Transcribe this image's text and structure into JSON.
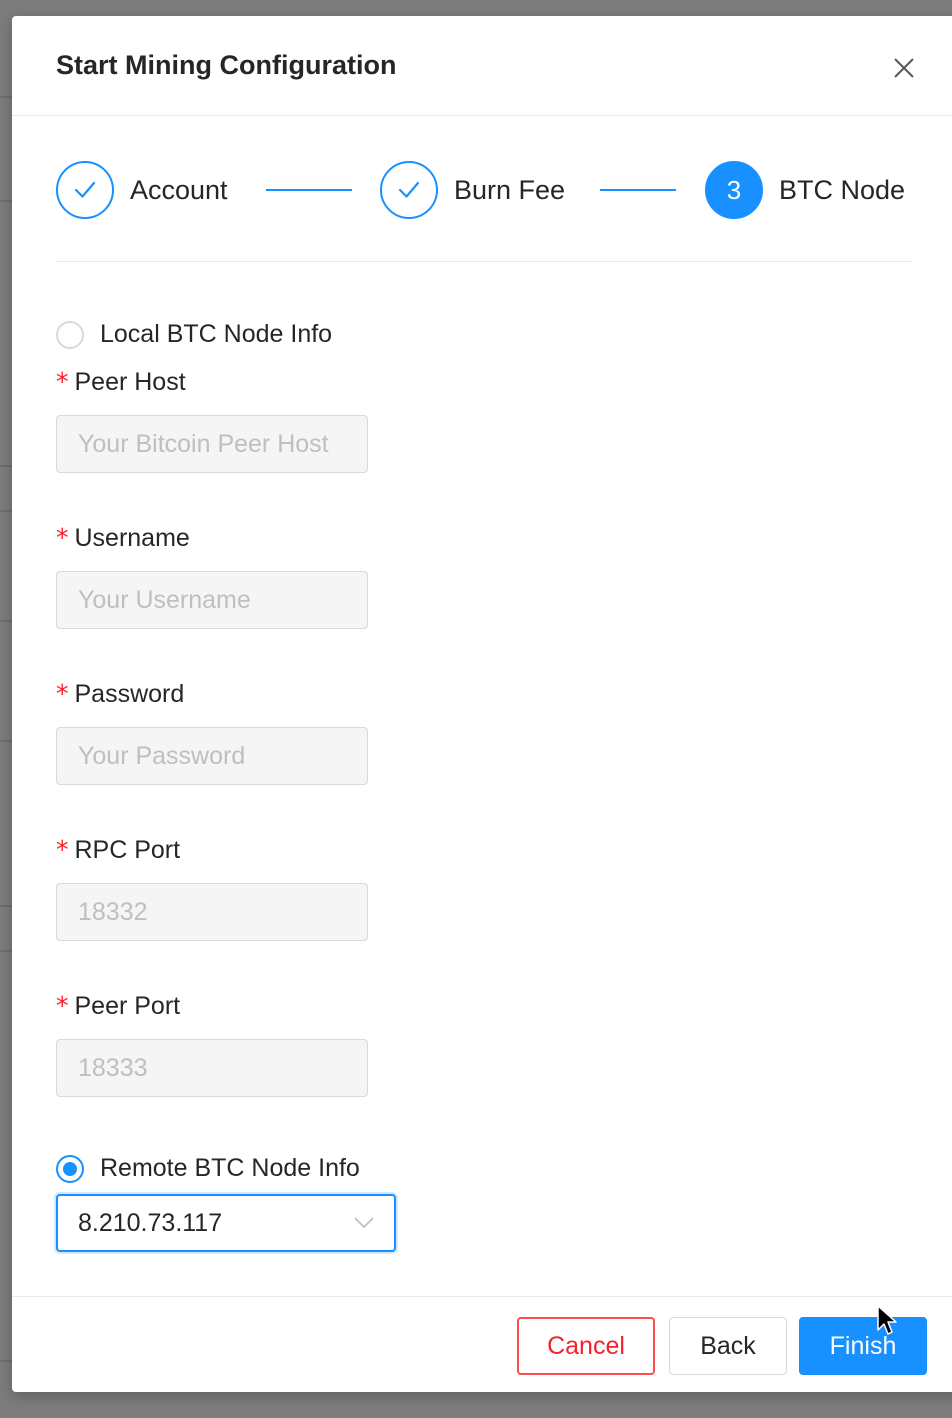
{
  "modal": {
    "title": "Start Mining Configuration"
  },
  "steps": [
    {
      "label": "Account",
      "status": "finished"
    },
    {
      "label": "Burn Fee",
      "status": "finished"
    },
    {
      "label": "BTC Node",
      "status": "active",
      "number": "3"
    }
  ],
  "local_node": {
    "radio_label": "Local BTC Node Info",
    "checked": false,
    "fields": [
      {
        "label": "Peer Host",
        "placeholder": "Your Bitcoin Peer Host",
        "required": true
      },
      {
        "label": "Username",
        "placeholder": "Your Username",
        "required": true
      },
      {
        "label": "Password",
        "placeholder": "Your Password",
        "required": true
      },
      {
        "label": "RPC Port",
        "placeholder": "18332",
        "required": true
      },
      {
        "label": "Peer Port",
        "placeholder": "18333",
        "required": true
      }
    ],
    "required_mark": "*"
  },
  "remote_node": {
    "radio_label": "Remote BTC Node Info",
    "checked": true,
    "selected_value": "8.210.73.117"
  },
  "footer": {
    "cancel_label": "Cancel",
    "back_label": "Back",
    "finish_label": "Finish"
  },
  "colors": {
    "primary": "#1890ff",
    "danger": "#f5222d",
    "text": "#262626",
    "placeholder": "#bfbfbf"
  },
  "icons": {
    "close": "close-icon",
    "check": "check-icon",
    "dropdown": "chevron-down-icon",
    "cursor": "mouse-pointer-icon"
  }
}
